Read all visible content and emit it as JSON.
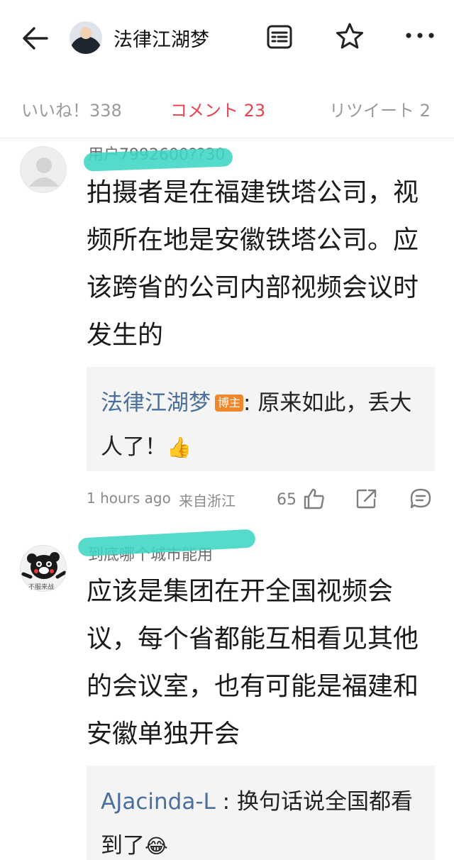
{
  "header": {
    "title": "法律江湖梦",
    "icons": [
      "back-arrow-icon",
      "avatar",
      "document-icon",
      "star-icon",
      "more-icon"
    ]
  },
  "tabs": {
    "likes": "いいね！338",
    "comments": "コメント 23",
    "retweets": "リツイート 2",
    "active_color": "#e8424f"
  },
  "comments": [
    {
      "username": "用户7992600??30",
      "text": "拍摄者是在福建铁塔公司，视频所在地是安徽铁塔公司。应该跨省的公司内部视频会议时发生的",
      "reply": {
        "author": "法律江湖梦",
        "badge": "博主",
        "sep": ":",
        "text": " 原来如此，丢大人了！",
        "emoji": "👍"
      },
      "time": "1 hours ago",
      "location": "来自浙江",
      "likes": "65"
    },
    {
      "username": "到底哪个城市能用",
      "text": "应该是集团在开全国视频会议，每个省都能互相看见其他的会议室，也有可能是福建和安徽单独开会",
      "avatar_caption": "不服来战",
      "reply": {
        "author": "AJacinda-L",
        "sep": " :",
        "text": " 换句话说全国都看到了",
        "emoji": "😂"
      }
    }
  ]
}
